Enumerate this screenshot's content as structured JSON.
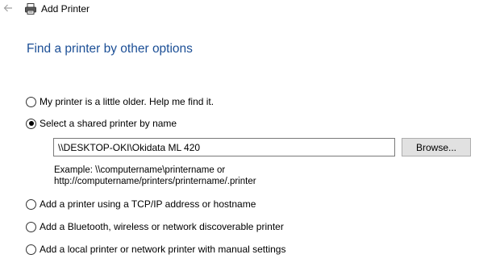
{
  "window": {
    "title": "Add Printer",
    "back_icon": "back-arrow-icon",
    "app_icon": "printer-icon"
  },
  "page": {
    "heading": "Find a printer by other options"
  },
  "options": [
    {
      "label": "My printer is a little older. Help me find it.",
      "checked": false
    },
    {
      "label": "Select a shared printer by name",
      "checked": true
    },
    {
      "label": "Add a printer using a TCP/IP address or hostname",
      "checked": false
    },
    {
      "label": "Add a Bluetooth, wireless or network discoverable printer",
      "checked": false
    },
    {
      "label": "Add a local printer or network printer with manual settings",
      "checked": false
    }
  ],
  "shared_printer": {
    "value": "\\\\DESKTOP-OKI\\Okidata ML 420",
    "browse_label": "Browse...",
    "example_line1": "Example: \\\\computername\\printername or",
    "example_line2": "http://computername/printers/printername/.printer"
  },
  "colors": {
    "heading": "#1c4f96",
    "button_bg": "#e1e1e1",
    "button_border": "#adadad",
    "input_border": "#7a7a7a"
  }
}
